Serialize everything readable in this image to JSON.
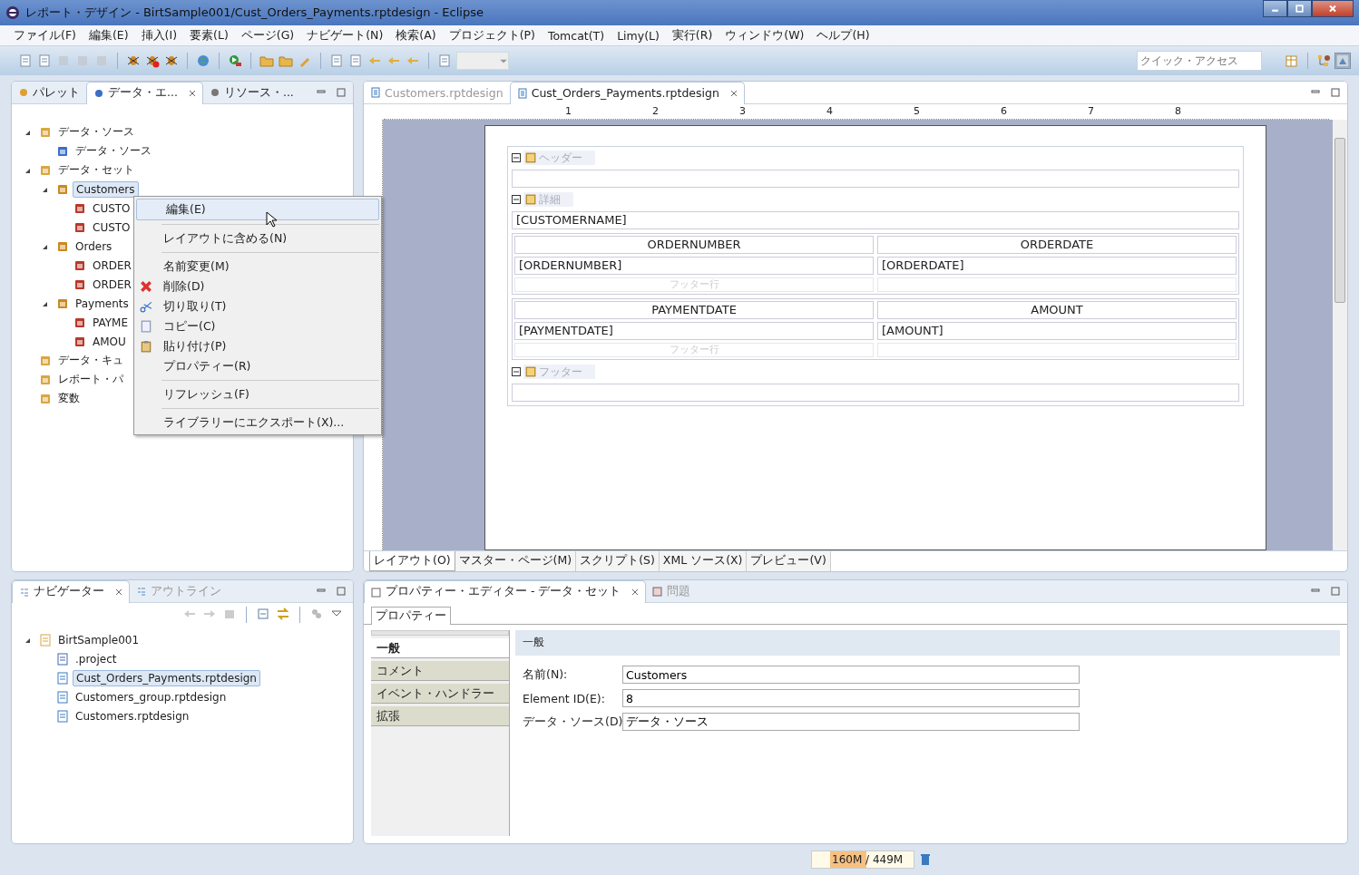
{
  "window": {
    "title": "レポート・デザイン - BirtSample001/Cust_Orders_Payments.rptdesign - Eclipse"
  },
  "menu": [
    "ファイル(F)",
    "編集(E)",
    "挿入(I)",
    "要素(L)",
    "ページ(G)",
    "ナビゲート(N)",
    "検索(A)",
    "プロジェクト(P)",
    "Tomcat(T)",
    "Limy(L)",
    "実行(R)",
    "ウィンドウ(W)",
    "ヘルプ(H)"
  ],
  "quick_access": {
    "placeholder": "クイック・アクセス"
  },
  "explorer": {
    "tabs": [
      {
        "label": "パレット",
        "selected": false
      },
      {
        "label": "データ・エ...",
        "selected": true
      },
      {
        "label": "リソース・...",
        "selected": false
      }
    ],
    "tree": [
      {
        "label": "データ・ソース",
        "kind": "folder",
        "expanded": true,
        "selected": false,
        "children": [
          {
            "label": "データ・ソース",
            "kind": "source",
            "selected": false
          }
        ]
      },
      {
        "label": "データ・セット",
        "kind": "folder",
        "expanded": true,
        "selected": false,
        "children": [
          {
            "label": "Customers",
            "kind": "dataset",
            "expanded": true,
            "selected": true,
            "children": [
              {
                "label": "CUSTO",
                "kind": "column",
                "selected": false
              },
              {
                "label": "CUSTO",
                "kind": "column",
                "selected": false
              }
            ]
          },
          {
            "label": "Orders",
            "kind": "dataset",
            "expanded": true,
            "selected": false,
            "children": [
              {
                "label": "ORDER",
                "kind": "column",
                "selected": false
              },
              {
                "label": "ORDER",
                "kind": "column",
                "selected": false
              }
            ]
          },
          {
            "label": "Payments",
            "kind": "dataset",
            "expanded": true,
            "selected": false,
            "children": [
              {
                "label": "PAYME",
                "kind": "column",
                "selected": false
              },
              {
                "label": "AMOU",
                "kind": "column",
                "selected": false
              }
            ]
          }
        ]
      },
      {
        "label": "データ・キュ",
        "kind": "folder",
        "selected": false
      },
      {
        "label": "レポート・パ",
        "kind": "folder",
        "selected": false
      },
      {
        "label": "変数",
        "kind": "folder",
        "selected": false
      }
    ]
  },
  "context_menu": [
    [
      {
        "label": "編集(E)",
        "selected": true
      }
    ],
    [
      {
        "label": "レイアウトに含める(N)",
        "selected": false
      }
    ],
    [
      {
        "label": "名前変更(M)",
        "selected": false
      },
      {
        "label": "削除(D)",
        "kind": "delete",
        "selected": false
      },
      {
        "label": "切り取り(T)",
        "kind": "cut",
        "selected": false
      },
      {
        "label": "コピー(C)",
        "kind": "copy",
        "selected": false
      },
      {
        "label": "貼り付け(P)",
        "kind": "paste",
        "selected": false
      },
      {
        "label": "プロパティー(R)",
        "selected": false
      }
    ],
    [
      {
        "label": "リフレッシュ(F)",
        "selected": false
      }
    ],
    [
      {
        "label": "ライブラリーにエクスポート(X)...",
        "selected": false
      }
    ]
  ],
  "editor": {
    "tabs": [
      {
        "label": "Customers.rptdesign",
        "selected": false
      },
      {
        "label": "Cust_Orders_Payments.rptdesign",
        "selected": true
      }
    ],
    "ruler": [
      "1",
      "2",
      "3",
      "4",
      "5",
      "6",
      "7",
      "8"
    ],
    "report": [
      {
        "kind": "band",
        "label": "ヘッダー"
      },
      {
        "kind": "empty"
      },
      {
        "kind": "band",
        "label": "詳細"
      },
      {
        "kind": "field",
        "text": "[CUSTOMERNAME]"
      },
      {
        "kind": "table",
        "header": [
          "ORDERNUMBER",
          "ORDERDATE"
        ],
        "row": [
          "[ORDERNUMBER]",
          "[ORDERDATE]"
        ],
        "footer": "フッター行"
      },
      {
        "kind": "table",
        "header": [
          "PAYMENTDATE",
          "AMOUNT"
        ],
        "row": [
          "[PAYMENTDATE]",
          "[AMOUNT]"
        ],
        "footer": "フッター行"
      },
      {
        "kind": "band",
        "label": "フッター"
      },
      {
        "kind": "empty"
      }
    ],
    "bottom_tabs": [
      {
        "label": "レイアウト(O)",
        "selected": true
      },
      {
        "label": "マスター・ページ(M)",
        "selected": false
      },
      {
        "label": "スクリプト(S)",
        "selected": false
      },
      {
        "label": "XML ソース(X)",
        "selected": false
      },
      {
        "label": "プレビュー(V)",
        "selected": false
      }
    ]
  },
  "navigator": {
    "tabs": [
      {
        "label": "ナビゲーター",
        "selected": true
      },
      {
        "label": "アウトライン",
        "selected": false
      }
    ],
    "tree": [
      {
        "label": "BirtSample001",
        "kind": "project",
        "expanded": true,
        "selected": false,
        "children": [
          {
            "label": ".project",
            "kind": "xml",
            "selected": false
          },
          {
            "label": "Cust_Orders_Payments.rptdesign",
            "kind": "report",
            "selected": true
          },
          {
            "label": "Customers_group.rptdesign",
            "kind": "report",
            "selected": false
          },
          {
            "label": "Customers.rptdesign",
            "kind": "report",
            "selected": false
          }
        ]
      }
    ]
  },
  "properties": {
    "tabs": [
      {
        "label": "プロパティー・エディター - データ・セット",
        "selected": true
      },
      {
        "label": "問題",
        "selected": false
      }
    ],
    "subtab": "プロパティー",
    "categories": [
      {
        "label": "一般",
        "selected": true
      },
      {
        "label": "コメント",
        "selected": false
      },
      {
        "label": "イベント・ハンドラー",
        "selected": false
      },
      {
        "label": "拡張",
        "selected": false
      }
    ],
    "section": "一般",
    "fields": [
      {
        "label": "名前(N):",
        "value": "Customers"
      },
      {
        "label": "Element ID(E):",
        "value": "8"
      },
      {
        "label": "データ・ソース(D)",
        "value": "データ・ソース"
      }
    ]
  },
  "status": {
    "memory": "160M / 449M",
    "level": 0.36
  }
}
